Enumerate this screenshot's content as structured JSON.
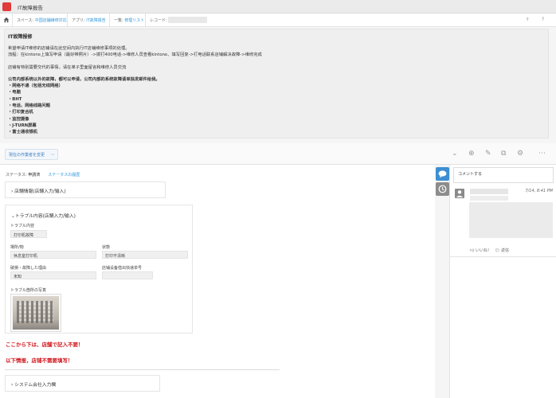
{
  "app": {
    "title": "IT故障报告"
  },
  "breadcrumb": {
    "space_prefix": "スペース: ",
    "space": "中国店舗維修対応",
    "app_prefix": "アプリ: ",
    "app": "IT故障报告",
    "list_prefix": "一覧: ",
    "list": "修理リスト",
    "record_prefix": "レコード: "
  },
  "notice": {
    "title": "IT故障报修",
    "lines": [
      "希望申请IT维修的店铺请在此空间内执行IT店铺维修事项的处理。",
      "流程：在kintone上填写申请（最好带照片）->拨打400电话->维修人员查看kintone、填写回复->打电话联系店铺解决故障->维修完成",
      "店铺有特别需要交代的事情，请在单子里面留言和维修人员交流",
      "公司内部系统以外的故障，都可以申请，公司内部的系统故障请单独发邮件给我。",
      "・网络不通（包括无线网络）",
      "・电脑",
      "・BHT",
      "・电话，网络线路问题",
      "・打印复合机",
      "・监控摄像",
      "・J-TURN屏幕",
      "・富士通收银机"
    ]
  },
  "toolbar": {
    "assignee_label": "現在の作業者を変更",
    "chevron": "⌵"
  },
  "status": {
    "label": "ステータス: ",
    "value": "申請済",
    "history_link": "ステータスの履歴"
  },
  "sections": {
    "store_info": "店舗情報(店舗入力/输入)",
    "trouble": "トラブル内容(店舗入力/输入)",
    "system": "システム会社入力欄"
  },
  "fields": {
    "trouble_content": {
      "label": "トラブル内容",
      "value": "打印机故障"
    },
    "location": {
      "label": "場所/物",
      "value": "休息室打印机"
    },
    "condition": {
      "label": "状態",
      "value": "打印不清晰"
    },
    "reason": {
      "label": "破損・故障した理由",
      "value": "未知"
    },
    "equipment_no": {
      "label": "店铺设备借出快递单号",
      "value": ""
    },
    "photo": {
      "label": "トラブル箇所の写真"
    }
  },
  "notes": {
    "from_here_jp": "ここから下は、店舗で記入不要！",
    "from_here_cn": "以下情报，店铺不需要填写！"
  },
  "comments": {
    "placeholder": "コメントする",
    "items": [
      {
        "time": "7/14, 8:41 PM",
        "like": "いいね！",
        "reply": "返信"
      }
    ]
  },
  "colors": {
    "brand": "#e03a3a",
    "link": "#3498db",
    "warning": "#d0161b",
    "tab_active": "#3d8fd1"
  }
}
